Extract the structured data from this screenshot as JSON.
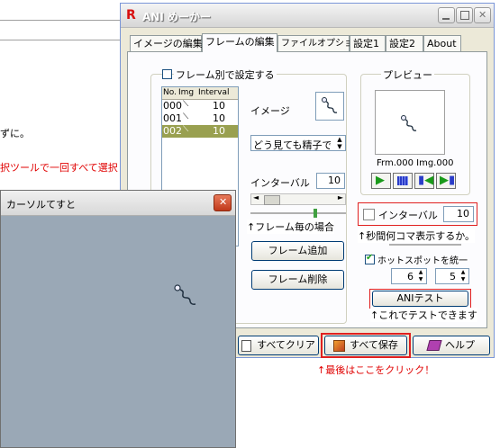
{
  "background_doc": {
    "line1": "ずに。",
    "line2": "択ツールで一回すべて選択"
  },
  "main_window": {
    "title": "ANI めーかー",
    "tabs": [
      "イメージの編集",
      "フレームの編集",
      "ファイルオプション",
      "設定1",
      "設定2",
      "About"
    ],
    "active_tab": "フレームの編集",
    "frame_group": {
      "checkbox_label": "フレーム別で設定する",
      "list_headers": [
        "No.",
        "Img",
        "Interval"
      ],
      "rows": [
        {
          "no": "000",
          "interval": "10"
        },
        {
          "no": "001",
          "interval": "10"
        },
        {
          "no": "002",
          "interval": "10"
        }
      ],
      "selected_row": 2,
      "image_label": "イメージ",
      "image_select_value": "どう見ても精子です",
      "interval_label": "インターバル",
      "interval_value": "10",
      "annotation_interval": "↑フレーム毎の場合",
      "add_frame_button": "フレーム追加",
      "delete_frame_button": "フレーム削除"
    },
    "preview_group": {
      "label": "プレビュー",
      "frame_info": "Frm.000 Img.000",
      "global_interval_label": "インターバル",
      "global_interval_value": "10",
      "annotation_seconds": "↑秒間何コマ表示するか。",
      "hotspot_label": "ホットスポットを統一",
      "hotspot_x": "6",
      "hotspot_y": "5",
      "test_button": "ANIテスト",
      "annotation_test": "↑これでテストできます"
    },
    "bottom_buttons": {
      "clear_all": "すべてクリア",
      "save_all": "すべて保存",
      "help": "ヘルプ"
    },
    "annotation_last": "↑最後はここをクリック！"
  },
  "cursor_window": {
    "title": "カーソルてすと"
  },
  "colors": {
    "red_annotation": "#e00000",
    "selected_row": "#99a050",
    "cursor_bg": "#9aa8b6",
    "play_green": "#1a9a1a",
    "blue_button": "#2a3cc8"
  }
}
